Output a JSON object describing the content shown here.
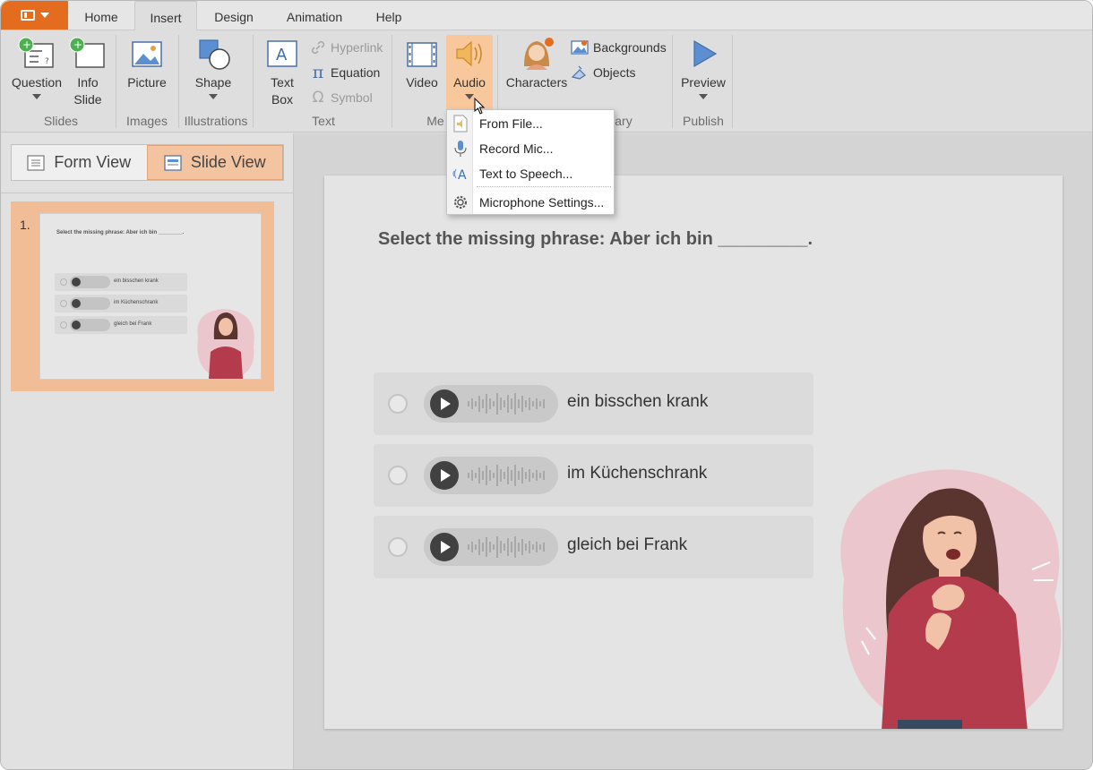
{
  "tabs": [
    "Home",
    "Insert",
    "Design",
    "Animation",
    "Help"
  ],
  "active_tab": "Insert",
  "ribbon": {
    "question": "Question",
    "info1": "Info",
    "info2": "Slide",
    "picture": "Picture",
    "shape": "Shape",
    "textbox1": "Text",
    "textbox2": "Box",
    "hyperlink": "Hyperlink",
    "equation": "Equation",
    "symbol": "Symbol",
    "video": "Video",
    "audio": "Audio",
    "characters": "Characters",
    "backgrounds": "Backgrounds",
    "objects": "Objects",
    "preview": "Preview",
    "groups": {
      "slides": "Slides",
      "images": "Images",
      "illustrations": "Illustrations",
      "text": "Text",
      "media": "Me",
      "library": "ary",
      "publish": "Publish"
    }
  },
  "audio_menu": [
    "From File...",
    "Record Mic...",
    "Text to Speech...",
    "Microphone Settings..."
  ],
  "view_tabs": {
    "form": "Form View",
    "slide": "Slide View"
  },
  "thumbnail": {
    "number": "1.",
    "question": "Select the missing phrase:  Aber ich bin ________.",
    "options": [
      "ein bisschen krank",
      "im Küchenschrank",
      "gleich bei Frank"
    ]
  },
  "slide": {
    "question": "Select the missing phrase:  Aber ich bin _________.",
    "options": [
      "ein bisschen krank",
      "im Küchenschrank",
      "gleich bei Frank"
    ]
  },
  "colors": {
    "accent": "#e46c1f",
    "selection": "#f4c4a0",
    "audio_highlight": "#f8c79c"
  }
}
